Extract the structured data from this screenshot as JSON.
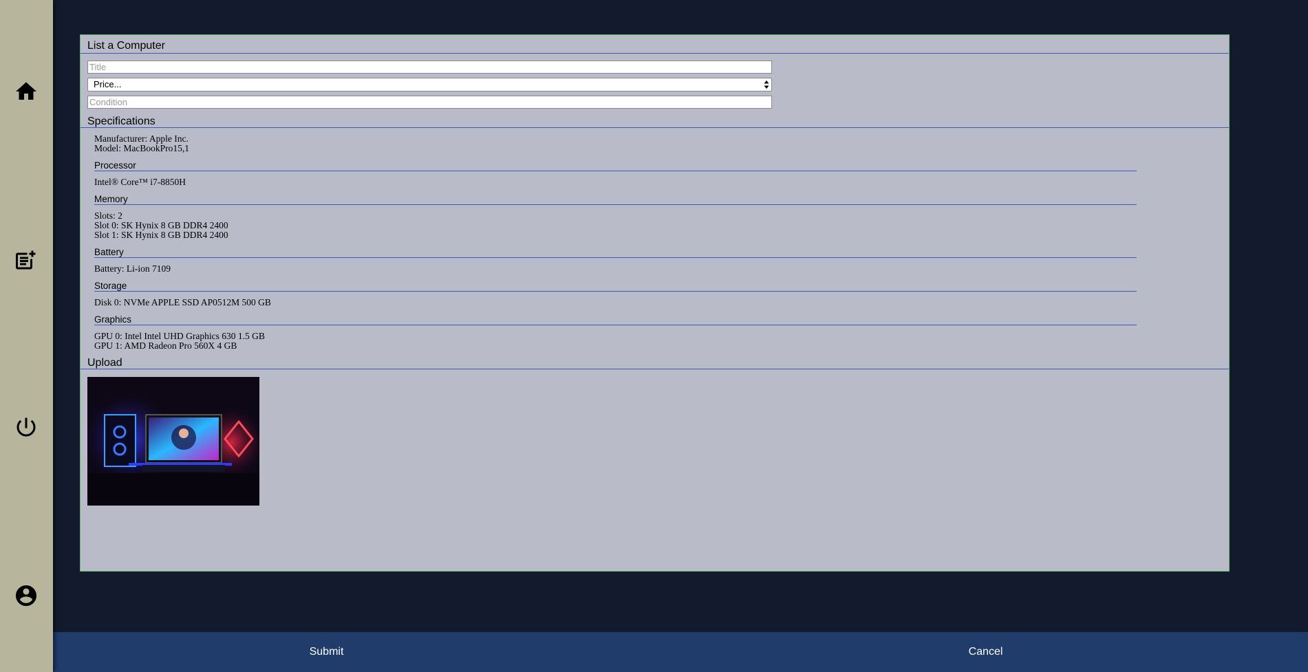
{
  "nav": {
    "items": [
      {
        "icon": "home-icon"
      },
      {
        "icon": "add-listing-icon"
      },
      {
        "icon": "power-icon"
      },
      {
        "icon": "account-icon"
      }
    ]
  },
  "form": {
    "title": "List a Computer",
    "title_placeholder": "Title",
    "title_value": "",
    "price_selected": "Price...",
    "condition_placeholder": "Condition",
    "condition_value": ""
  },
  "specs": {
    "title": "Specifications",
    "manufacturer": "Manufacturer: Apple Inc.",
    "model": "Model: MacBookPro15,1",
    "processor": {
      "title": "Processor",
      "lines": [
        "Intel® Core™ i7-8850H"
      ]
    },
    "memory": {
      "title": "Memory",
      "lines": [
        "Slots: 2",
        "Slot 0: SK Hynix 8 GB DDR4 2400",
        "Slot 1: SK Hynix 8 GB DDR4 2400"
      ]
    },
    "battery": {
      "title": "Battery",
      "lines": [
        "Battery: Li-ion 7109"
      ]
    },
    "storage": {
      "title": "Storage",
      "lines": [
        "Disk 0: NVMe APPLE SSD AP0512M 500 GB"
      ]
    },
    "graphics": {
      "title": "Graphics",
      "lines": [
        "GPU 0: Intel Intel UHD Graphics 630 1.5 GB",
        "GPU 1: AMD Radeon Pro 560X 4 GB"
      ]
    }
  },
  "upload": {
    "title": "Upload"
  },
  "footer": {
    "submit_label": "Submit",
    "cancel_label": "Cancel"
  },
  "colors": {
    "background": "#131a2e",
    "sidebar": "#b7b59c",
    "panel": "#b9bbc9",
    "panel_border": "#5fb86a",
    "rule": "#3a5cab",
    "footer": "#1f3c6b"
  }
}
